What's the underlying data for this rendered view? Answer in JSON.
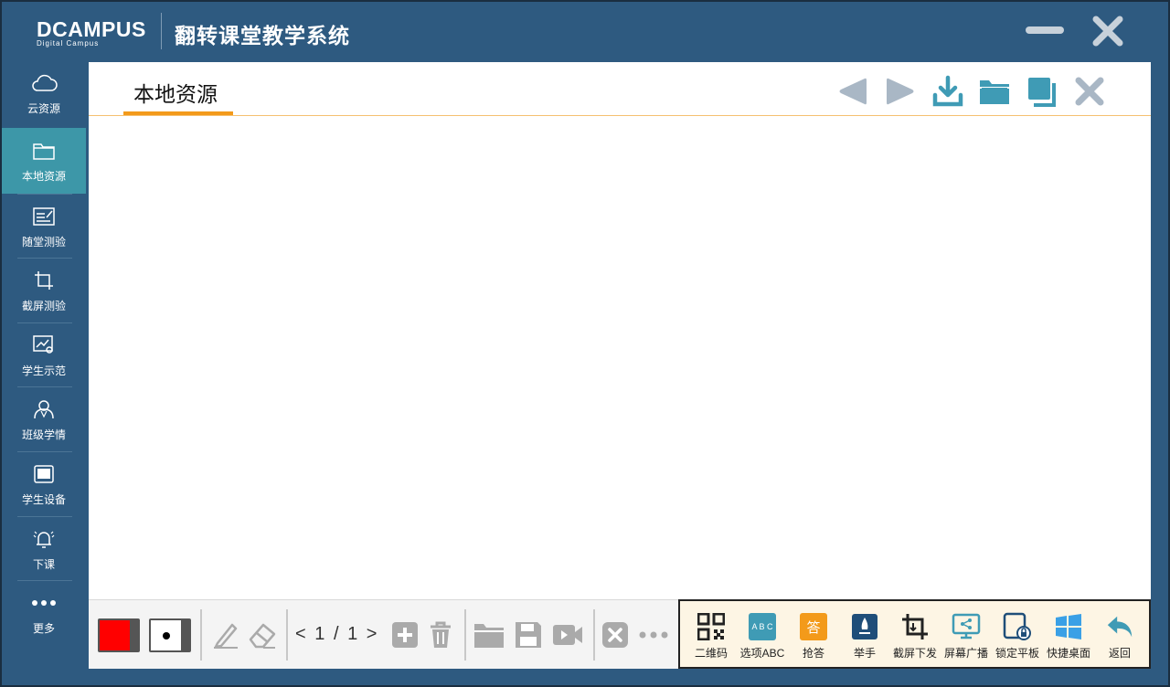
{
  "app": {
    "logo_main": "DCAMPUS",
    "logo_sub": "Digital Campus",
    "title": "翻转课堂教学系统"
  },
  "sidebar": {
    "items": [
      {
        "label": "云资源",
        "icon": "cloud-icon"
      },
      {
        "label": "本地资源",
        "icon": "folder-icon",
        "active": true
      },
      {
        "label": "随堂测验",
        "icon": "quiz-icon"
      },
      {
        "label": "截屏测验",
        "icon": "crop-icon"
      },
      {
        "label": "学生示范",
        "icon": "demo-icon"
      },
      {
        "label": "班级学情",
        "icon": "class-icon"
      },
      {
        "label": "学生设备",
        "icon": "tablet-icon"
      },
      {
        "label": "下课",
        "icon": "bell-icon"
      },
      {
        "label": "更多",
        "icon": "more-icon"
      }
    ]
  },
  "main": {
    "tab_label": "本地资源",
    "accent": "#f39a1a",
    "tools": [
      "prev-icon",
      "next-icon",
      "download-icon",
      "open-folder-icon",
      "copy-icon",
      "close-icon"
    ]
  },
  "bottombar": {
    "pen_color": "#ff0000",
    "pager": {
      "prev": "<",
      "current": "1",
      "sep": "/",
      "total": "1",
      "next": ">"
    }
  },
  "rightbar": {
    "items": [
      {
        "label": "二维码",
        "icon": "qrcode-icon"
      },
      {
        "label": "选项ABC",
        "icon": "abc-option-icon",
        "icon_text": "A B C"
      },
      {
        "label": "抢答",
        "icon": "quick-answer-icon",
        "icon_text": "答"
      },
      {
        "label": "举手",
        "icon": "raise-hand-icon"
      },
      {
        "label": "截屏下发",
        "icon": "screenshot-send-icon"
      },
      {
        "label": "屏幕广播",
        "icon": "broadcast-icon"
      },
      {
        "label": "锁定平板",
        "icon": "lock-tablet-icon"
      },
      {
        "label": "快捷桌面",
        "icon": "windows-icon"
      },
      {
        "label": "返回",
        "icon": "back-icon"
      }
    ]
  }
}
